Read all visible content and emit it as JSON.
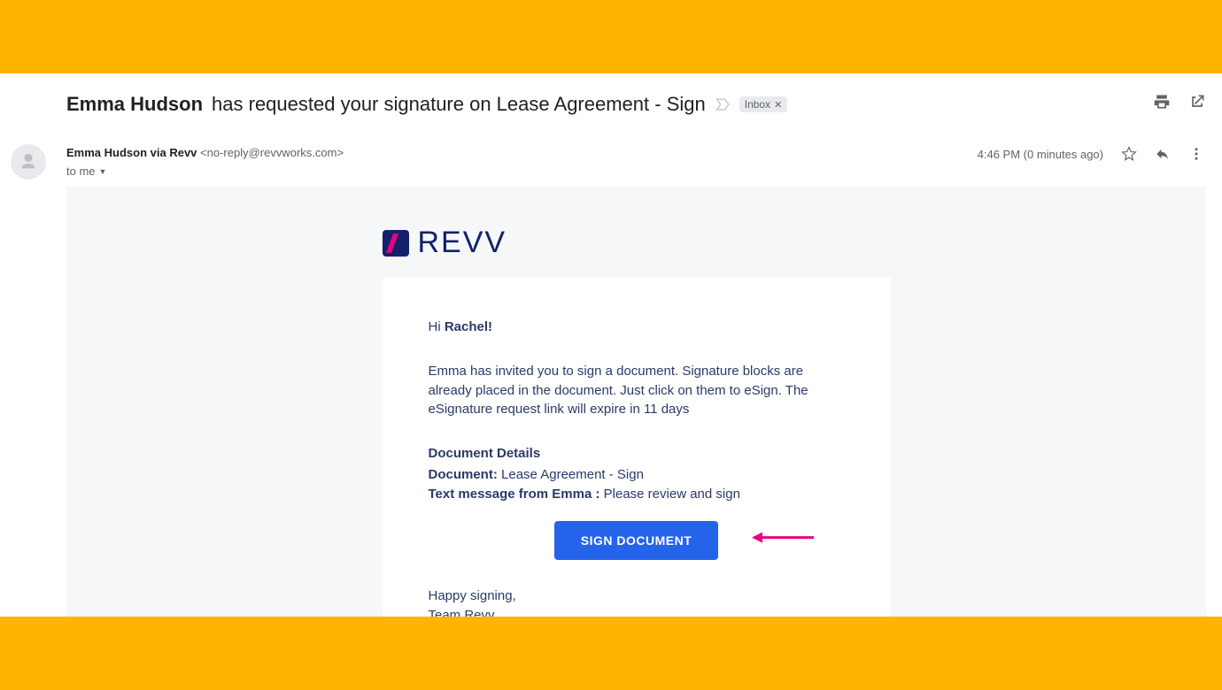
{
  "subject": {
    "sender_name": "Emma Hudson",
    "rest": "has requested your signature on Lease Agreement - Sign",
    "inbox_label": "Inbox"
  },
  "meta": {
    "sender_name": "Emma Hudson",
    "via": "via Revv",
    "sender_email": "<no-reply@revvworks.com>",
    "to_line": "to me",
    "timestamp": "4:46 PM (0 minutes ago)"
  },
  "logo": {
    "text": "REVV"
  },
  "body": {
    "greeting_prefix": "Hi ",
    "greeting_name": "Rachel!",
    "inviter_name": "Emma",
    "invite_text": " has invited you to sign a document. Signature blocks are already placed in the document. Just click on them to eSign. The eSignature request link will expire in 11 days",
    "details_title": "Document Details",
    "document_label": "Document:",
    "document_value": " Lease Agreement - Sign",
    "message_label_prefix": "Text message from ",
    "message_from_name": "Emma",
    "message_label_suffix": " :",
    "message_value": " Please review and sign",
    "sign_button": "SIGN DOCUMENT",
    "closing_line1": "Happy signing,",
    "closing_line2": "Team Revv"
  }
}
